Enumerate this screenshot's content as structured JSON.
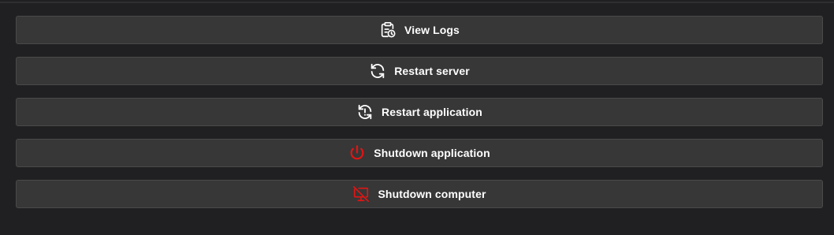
{
  "actions": [
    {
      "label": "View Logs",
      "icon": "clipboard-clock-icon",
      "icon_color": "#ffffff"
    },
    {
      "label": "Restart server",
      "icon": "refresh-icon",
      "icon_color": "#ffffff"
    },
    {
      "label": "Restart application",
      "icon": "refresh-alert-icon",
      "icon_color": "#ffffff"
    },
    {
      "label": "Shutdown application",
      "icon": "power-icon",
      "icon_color": "#e31414"
    },
    {
      "label": "Shutdown computer",
      "icon": "monitor-off-icon",
      "icon_color": "#e31414"
    }
  ],
  "colors": {
    "background": "#202022",
    "button_bg": "#373737",
    "button_border": "#4a4a4a",
    "label_text": "#ffffff",
    "danger": "#e31414"
  }
}
